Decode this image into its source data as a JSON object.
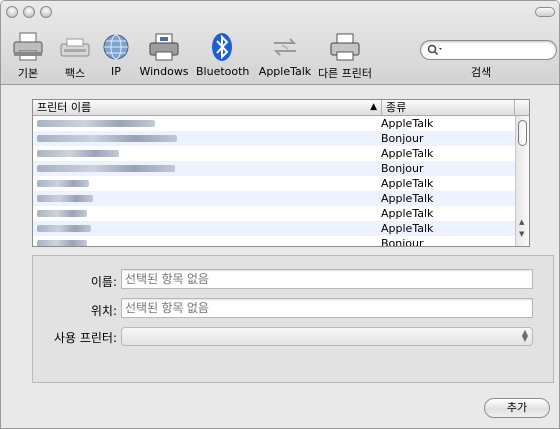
{
  "toolbar": {
    "items": [
      {
        "label": "기본",
        "icon": "printer-default-icon"
      },
      {
        "label": "팩스",
        "icon": "fax-icon"
      },
      {
        "label": "IP",
        "icon": "ip-globe-icon"
      },
      {
        "label": "Windows",
        "icon": "windows-printer-icon"
      },
      {
        "label": "Bluetooth",
        "icon": "bluetooth-icon"
      },
      {
        "label": "AppleTalk",
        "icon": "appletalk-icon"
      },
      {
        "label": "다른 프린터",
        "icon": "more-printers-icon"
      }
    ],
    "search_label": "검색",
    "search_value": ""
  },
  "printer_list": {
    "columns": {
      "name": "프린터 이름",
      "kind": "종류"
    },
    "rows": [
      {
        "name": "",
        "kind": "AppleTalk"
      },
      {
        "name": "",
        "kind": "Bonjour"
      },
      {
        "name": "",
        "kind": "AppleTalk"
      },
      {
        "name": "",
        "kind": "Bonjour"
      },
      {
        "name": "",
        "kind": "AppleTalk"
      },
      {
        "name": "",
        "kind": "AppleTalk"
      },
      {
        "name": "",
        "kind": "AppleTalk"
      },
      {
        "name": "",
        "kind": "AppleTalk"
      },
      {
        "name": "",
        "kind": "Bonjour"
      }
    ]
  },
  "info_panel": {
    "name_label": "이름:",
    "name_placeholder": "선택된 항목 없음",
    "location_label": "위치:",
    "location_placeholder": "선택된 항목 없음",
    "use_label": "사용 프린터:",
    "use_value": ""
  },
  "buttons": {
    "add": "추가"
  }
}
